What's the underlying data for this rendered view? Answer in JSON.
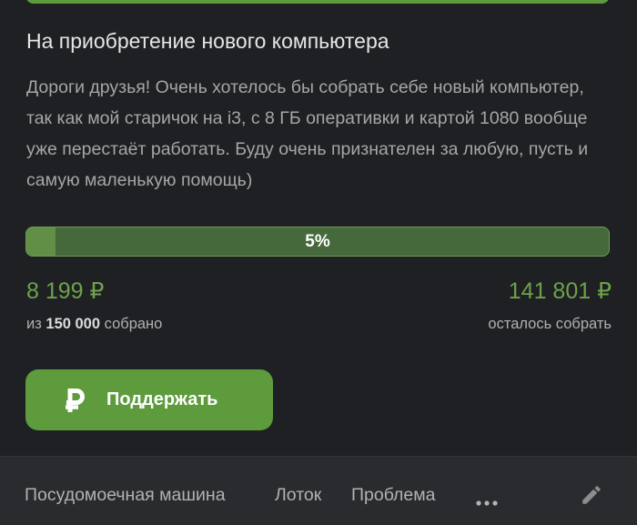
{
  "post": {
    "title": "На приобретение нового компьютера",
    "description": "Дороги друзья! Очень хотелось бы собрать себе новый компьютер, так как мой старичок на i3, с 8 ГБ оперативки и картой 1080 вообще уже перестаёт работать. Буду очень признателен за любую, пусть и самую маленькую помощь)"
  },
  "fundraiser": {
    "progress_percent": 5,
    "progress_label": "5%",
    "collected_amount": "8 199 ₽",
    "goal_prefix": "из",
    "goal_amount": "150 000",
    "goal_suffix": "собрано",
    "remaining_amount": "141 801 ₽",
    "remaining_label": "осталось собрать",
    "support_button_label": "Поддержать",
    "support_icon": "ruble-icon"
  },
  "tags": {
    "items": [
      "Посудомоечная машина",
      "Лоток",
      "Проблема"
    ],
    "more_icon": "more-horizontal-icon",
    "edit_icon": "pencil-icon"
  },
  "colors": {
    "accent_green": "#5d9b3d",
    "amount_green": "#6da24b",
    "background": "#1f2023",
    "tags_bar_background": "#2a2b2e"
  }
}
